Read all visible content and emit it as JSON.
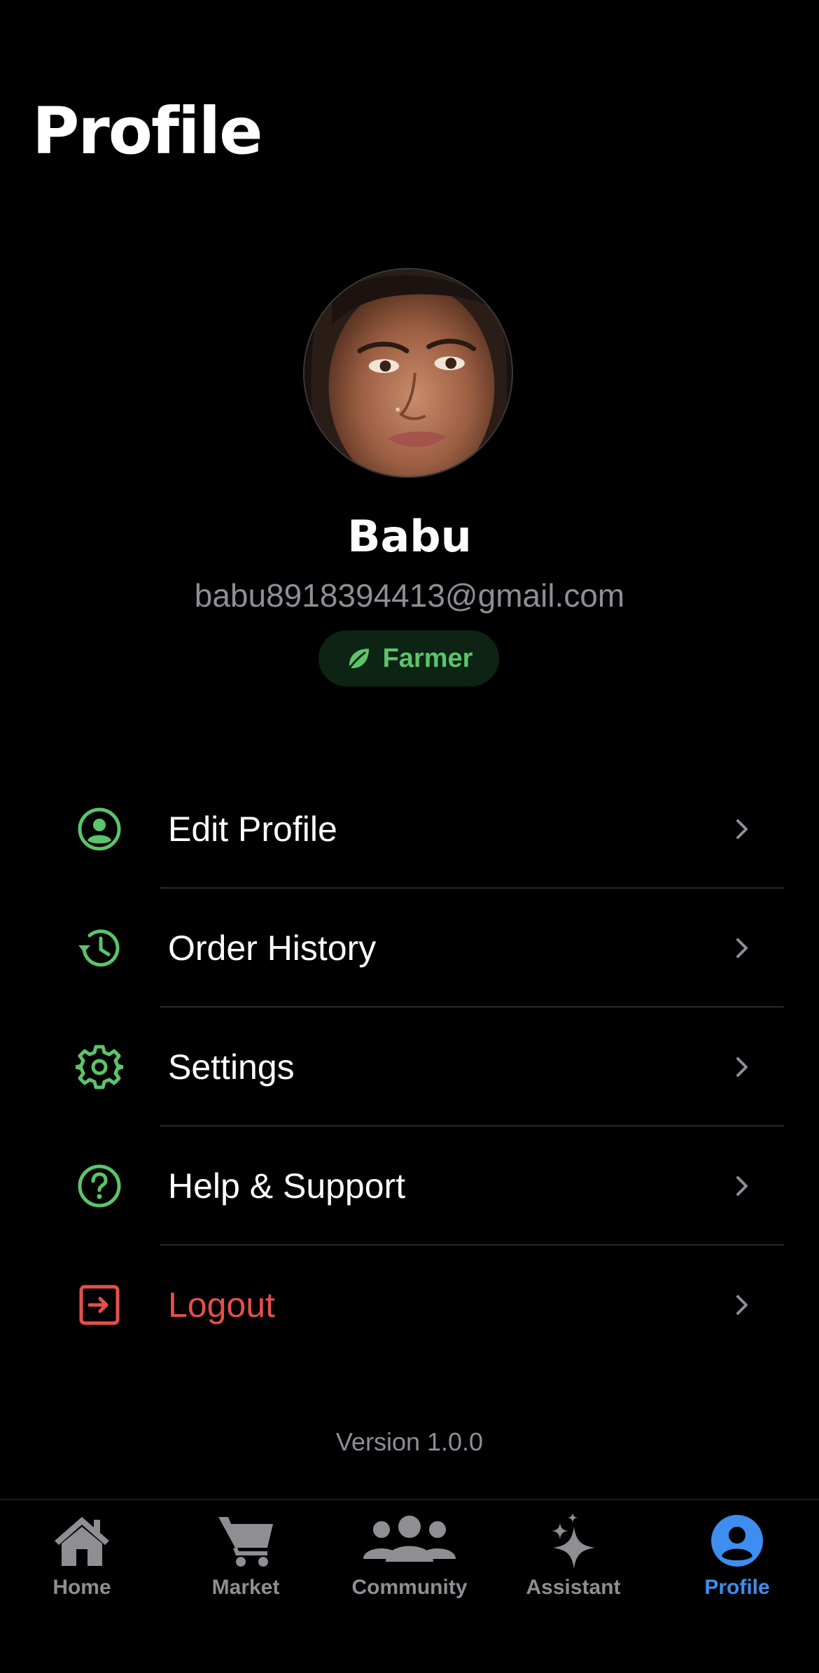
{
  "header": {
    "title": "Profile"
  },
  "user": {
    "name": "Babu",
    "email": "babu8918394413@gmail.com",
    "role": "Farmer"
  },
  "menu": [
    {
      "label": "Edit Profile",
      "icon": "person-circle-icon"
    },
    {
      "label": "Order History",
      "icon": "history-icon"
    },
    {
      "label": "Settings",
      "icon": "gear-icon"
    },
    {
      "label": "Help & Support",
      "icon": "help-icon"
    },
    {
      "label": "Logout",
      "icon": "logout-icon"
    }
  ],
  "version": "Version 1.0.0",
  "tabs": [
    {
      "label": "Home",
      "icon": "home-icon"
    },
    {
      "label": "Market",
      "icon": "cart-icon"
    },
    {
      "label": "Community",
      "icon": "people-icon"
    },
    {
      "label": "Assistant",
      "icon": "sparkles-icon"
    },
    {
      "label": "Profile",
      "icon": "person-icon",
      "active": true
    }
  ],
  "colors": {
    "accent_green": "#5cc46a",
    "danger_red": "#e5504a",
    "active_blue": "#3d8ef0",
    "muted_gray": "#8e8e93"
  }
}
